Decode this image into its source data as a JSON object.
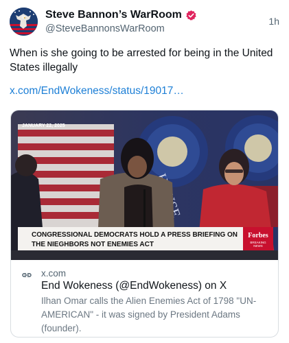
{
  "author": {
    "display_name": "Steve Bannon’s WarRoom",
    "handle": "@SteveBannonsWarRoom",
    "timestamp": "1h",
    "verified_color": "#e0245e"
  },
  "tweet": {
    "text": "When is she going to be arrested for being in the United States illegally",
    "link_text": "x.com/EndWokeness/status/19017…",
    "link_color": "#1d7fd6"
  },
  "media": {
    "date_label": "JANUARY 22, 2025",
    "lower_third_line1": "CONGRESSIONAL DEMOCRATS HOLD A PRESS BRIEFING ON",
    "lower_third_line2": "THE NIEGHBORS NOT ENEMIES ACT",
    "brand_name": "Forbes",
    "brand_sub1": "BREAKING",
    "brand_sub2": "NEWS",
    "seal_text": "HOUSE"
  },
  "card": {
    "domain": "x.com",
    "title": "End Wokeness (@EndWokeness) on X",
    "description": "Ilhan Omar calls the Alien Enemies Act of 1798 \"UN-AMERICAN\" - it was signed by President Adams (founder)."
  }
}
